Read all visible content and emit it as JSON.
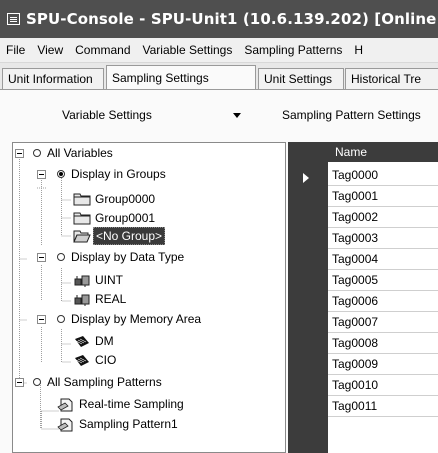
{
  "window": {
    "title": "SPU-Console - SPU-Unit1 (10.6.139.202) [Online"
  },
  "menu": [
    "File",
    "View",
    "Command",
    "Variable Settings",
    "Sampling Patterns",
    "H"
  ],
  "tabs": [
    "Unit Information",
    "Sampling Settings",
    "Unit Settings",
    "Historical Tre"
  ],
  "active_tab": "Sampling Settings",
  "toolbar": {
    "variable_settings": "Variable Settings",
    "sampling_pattern_settings": "Sampling Pattern Settings"
  },
  "tree": {
    "all_variables": "All Variables",
    "display_in_groups": "Display in Groups",
    "group0": "Group0000",
    "group1": "Group0001",
    "no_group": "<No Group>",
    "display_by_type": "Display by Data Type",
    "uint": "UINT",
    "real": "REAL",
    "display_by_memory": "Display by Memory Area",
    "dm": "DM",
    "cio": "CIO",
    "all_sampling": "All Sampling Patterns",
    "realtime": "Real-time Sampling",
    "pattern1": "Sampling Pattern1"
  },
  "grid": {
    "header": "Name",
    "rows": [
      "Tag0000",
      "Tag0001",
      "Tag0002",
      "Tag0003",
      "Tag0004",
      "Tag0005",
      "Tag0006",
      "Tag0007",
      "Tag0008",
      "Tag0009",
      "Tag0010",
      "Tag0011"
    ]
  }
}
